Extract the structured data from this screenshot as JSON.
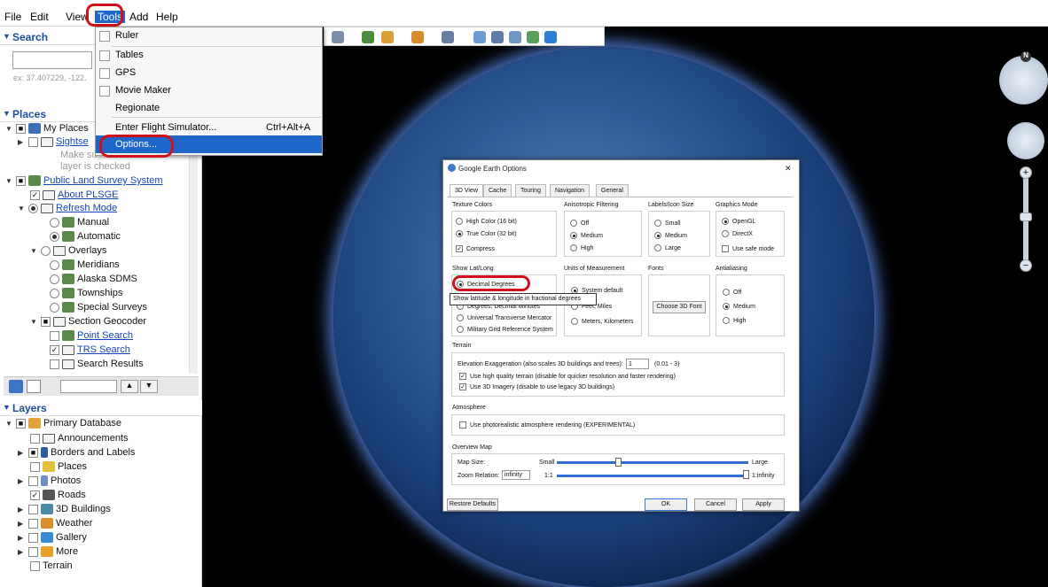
{
  "menubar": {
    "file": "File",
    "edit": "Edit",
    "view": "View",
    "tools": "Tools",
    "add": "Add",
    "help": "Help"
  },
  "tools_menu": {
    "items": [
      {
        "label": "Ruler"
      },
      {
        "label": "Tables"
      },
      {
        "label": "GPS"
      },
      {
        "label": "Movie Maker"
      },
      {
        "label": "Regionate"
      },
      {
        "label": "Enter Flight Simulator...",
        "shortcut": "Ctrl+Alt+A"
      },
      {
        "label": "Options..."
      }
    ]
  },
  "search": {
    "title": "Search",
    "placeholder": "ex: 37.407229, -122."
  },
  "places": {
    "title": "Places",
    "my_places": "My Places",
    "sightseeing": "Sightse",
    "hint1": "Make su",
    "hint2": "layer is checked",
    "plss": "Public Land Survey System",
    "about": "About PLSGE",
    "refresh": "Refresh Mode",
    "manual": "Manual",
    "automatic": "Automatic",
    "overlays": "Overlays",
    "meridians": "Meridians",
    "alaska": "Alaska SDMS",
    "townships": "Townships",
    "special": "Special Surveys",
    "section": "Section Geocoder",
    "point": "Point Search",
    "trs": "TRS Search",
    "results": "Search Results"
  },
  "layers": {
    "title": "Layers",
    "primary": "Primary Database",
    "items": [
      "Announcements",
      "Borders and Labels",
      "Places",
      "Photos",
      "Roads",
      "3D Buildings",
      "Weather",
      "Gallery",
      "More",
      "Terrain"
    ]
  },
  "dialog": {
    "title": "Google Earth Options",
    "close": "✕",
    "tabs": [
      "3D View",
      "Cache",
      "Touring",
      "Navigation",
      "General"
    ],
    "texture": {
      "title": "Texture Colors",
      "high": "High Color (16 bit)",
      "true": "True Color (32 bit)",
      "compress": "Compress"
    },
    "aniso": {
      "title": "Anisotropic Filtering",
      "off": "Off",
      "medium": "Medium",
      "high": "High"
    },
    "labels": {
      "title": "Labels/Icon Size",
      "small": "Small",
      "medium": "Medium",
      "large": "Large"
    },
    "graphics": {
      "title": "Graphics Mode",
      "opengl": "OpenGL",
      "directx": "DirectX",
      "safe": "Use safe mode"
    },
    "latlong": {
      "title": "Show Lat/Long",
      "decimal": "Decimal Degrees",
      "dms": "Degrees, Decimal Minutes",
      "utm": "Universal Transverse Mercator",
      "mgrs": "Military Grid Reference System"
    },
    "tooltip": "Show latitude & longitude in fractional degrees",
    "units": {
      "title": "Units of Measurement",
      "sys": "System default",
      "feet": "Feet, Miles",
      "meters": "Meters, Kilometers"
    },
    "fonts": {
      "title": "Fonts",
      "choose": "Choose 3D Font"
    },
    "aa": {
      "title": "Antialiasing",
      "off": "Off",
      "medium": "Medium",
      "high": "High"
    },
    "terrain": {
      "title": "Terrain",
      "elev": "Elevation Exaggeration (also scales 3D buildings and trees):",
      "elev_value": "1",
      "range": "(0.01 - 3)",
      "hq": "Use high quality terrain (disable for quicker resolution and faster rendering)",
      "imagery": "Use 3D Imagery (disable to use legacy 3D buildings)"
    },
    "atmosphere": {
      "title": "Atmosphere",
      "photo": "Use photorealistic atmosphere rendering (EXPERIMENTAL)"
    },
    "overview": {
      "title": "Overview Map",
      "size": "Map Size:",
      "small": "Small",
      "large": "Large",
      "zoom": "Zoom Relation:",
      "zoom_value": "infinity",
      "one": "1:1",
      "inf": "1:infinity"
    },
    "buttons": {
      "restore": "Restore Defaults",
      "ok": "OK",
      "cancel": "Cancel",
      "apply": "Apply"
    }
  },
  "nav": {
    "north": "N"
  }
}
